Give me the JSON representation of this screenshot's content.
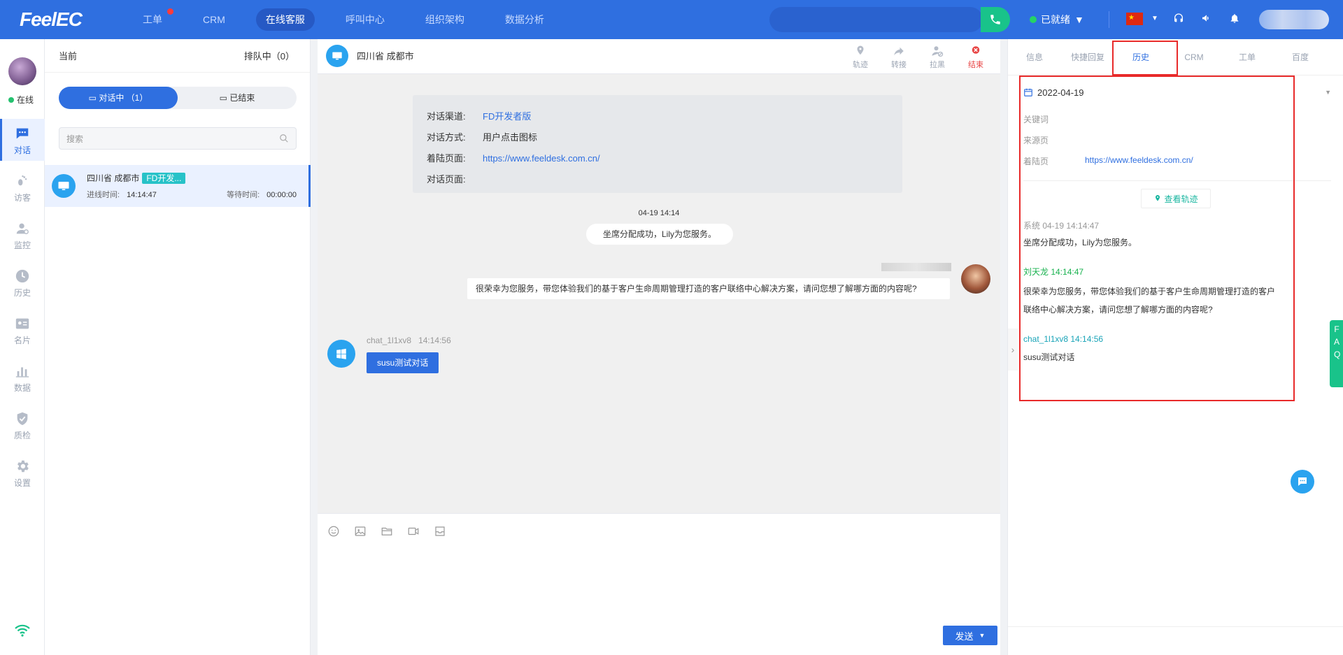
{
  "topbar": {
    "logo": "FeelEC",
    "nav": [
      {
        "label": "工单",
        "badge": true
      },
      {
        "label": "CRM"
      },
      {
        "label": "在线客服",
        "active": true
      },
      {
        "label": "呼叫中心"
      },
      {
        "label": "组织架构"
      },
      {
        "label": "数据分析"
      }
    ],
    "status_label": "已就绪"
  },
  "sidebar": {
    "status": "在线",
    "items": [
      {
        "label": "对话",
        "icon": "chat-icon",
        "active": true
      },
      {
        "label": "访客",
        "icon": "footprint-icon"
      },
      {
        "label": "监控",
        "icon": "monitor-user-icon"
      },
      {
        "label": "历史",
        "icon": "clock-icon"
      },
      {
        "label": "名片",
        "icon": "card-icon"
      },
      {
        "label": "数据",
        "icon": "bar-chart-icon"
      },
      {
        "label": "质检",
        "icon": "shield-check-icon"
      },
      {
        "label": "设置",
        "icon": "gear-icon"
      }
    ]
  },
  "convlist": {
    "current_label": "当前",
    "queue_label": "排队中（0）",
    "tab_active": "对话中 （1）",
    "tab_ended": "已结束",
    "search_placeholder": "搜索",
    "card": {
      "title": "四川省 成都市",
      "tag": "FD开发...",
      "in_time_label": "进线时间:",
      "in_time": "14:14:47",
      "wait_label": "等待时间:",
      "wait_time": "00:00:00"
    }
  },
  "chat": {
    "title": "四川省 成都市",
    "tools": [
      "轨迹",
      "转接",
      "拉黑",
      "结束"
    ],
    "info": {
      "channel_label": "对话渠道:",
      "channel_value": "FD开发者版",
      "mode_label": "对话方式:",
      "mode_value": "用户点击图标",
      "landing_label": "着陆页面:",
      "landing_value": "https://www.feeldesk.com.cn/",
      "page_label": "对话页面:",
      "page_value": ""
    },
    "timestamp": "04-19 14:14",
    "system_msg": "坐席分配成功，Lily为您服务。",
    "agent_msg": "很荣幸为您服务，带您体验我们的基于客户生命周期管理打造的客户联络中心解决方案，请问您想了解哪方面的内容呢?",
    "visitor_name": "chat_1l1xv8",
    "visitor_time": "14:14:56",
    "visitor_msg": "susu测试对话",
    "send_label": "发送"
  },
  "right": {
    "tabs": [
      "信息",
      "快捷回复",
      "历史",
      "CRM",
      "工单",
      "百度"
    ],
    "active_tab": "历史",
    "date": "2022-04-19",
    "keyword_label": "关键词",
    "source_label": "来源页",
    "landing_label": "着陆页",
    "landing_value": "https://www.feeldesk.com.cn/",
    "track_button": "查看轨迹",
    "hist_sys_header": "系统 04-19 14:14:47",
    "hist_sys_msg": "坐席分配成功，Lily为您服务。",
    "hist_agent_header": "刘天龙  14:14:47",
    "hist_agent_msg": "很荣幸为您服务，带您体验我们的基于客户生命周期管理打造的客户联络中心解决方案，请问您想了解哪方面的内容呢?",
    "hist_visitor_header": "chat_1l1xv8  14:14:56",
    "hist_visitor_msg": "susu测试对话",
    "faq": "FAQ"
  },
  "colors": {
    "primary": "#2f6fe0",
    "green": "#19c38a",
    "highlight_red": "#e82a2a"
  }
}
